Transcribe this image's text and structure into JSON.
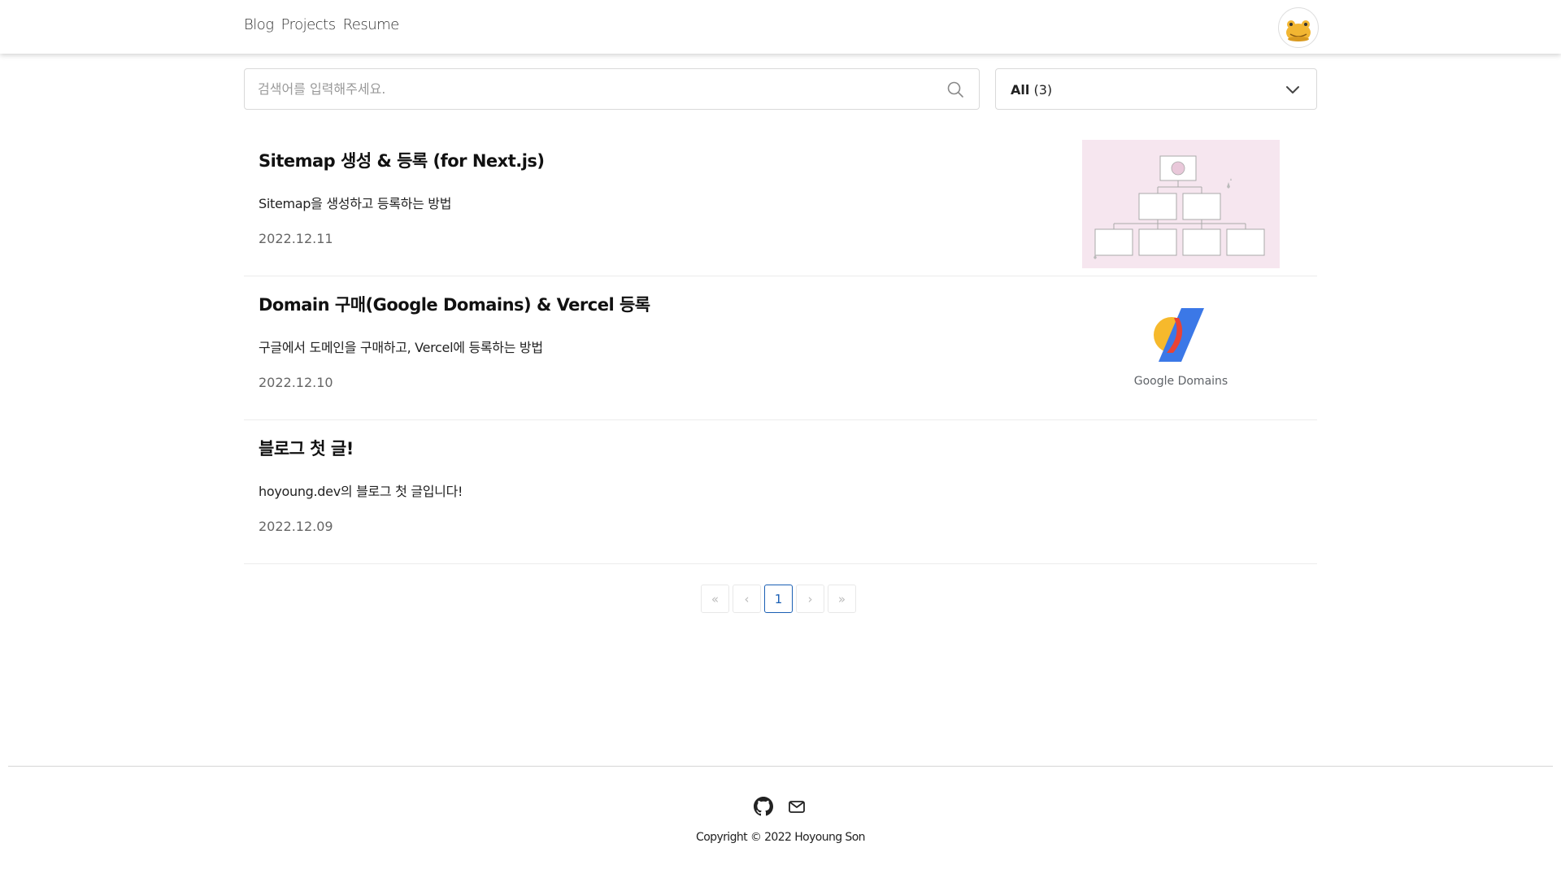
{
  "nav": {
    "items": [
      "Blog",
      "Projects",
      "Resume"
    ]
  },
  "header": {
    "avatar_icon": "frog-avatar-icon"
  },
  "search": {
    "placeholder": "검색어를 입력해주세요.",
    "value": "",
    "icon": "search-icon"
  },
  "filter": {
    "selected_label": "All",
    "selected_count": "(3)",
    "icon": "chevron-down-icon"
  },
  "posts": [
    {
      "title": "Sitemap 생성 & 등록 (for Next.js)",
      "description": "Sitemap을 생성하고 등록하는 방법",
      "date": "2022.12.11",
      "thumbnail": "sitemap-diagram"
    },
    {
      "title": "Domain 구매(Google Domains) & Vercel 등록",
      "description": "구글에서 도메인을 구매하고, Vercel에 등록하는 방법",
      "date": "2022.12.10",
      "thumbnail": "google-domains-logo",
      "thumbnail_text": "Google Domains"
    },
    {
      "title": "블로그 첫 글!",
      "description": "hoyoung.dev의 블로그 첫 글입니다!",
      "date": "2022.12.09",
      "thumbnail": ""
    }
  ],
  "pagination": {
    "first": "«",
    "prev": "‹",
    "current": "1",
    "next": "›",
    "last": "»"
  },
  "footer": {
    "icons": [
      "github-icon",
      "mail-icon"
    ],
    "copyright": "Copyright © 2022 Hoyoung Son"
  },
  "colors": {
    "accent": "#1a5fb4",
    "thumb_bg": "#f6e6ef"
  }
}
